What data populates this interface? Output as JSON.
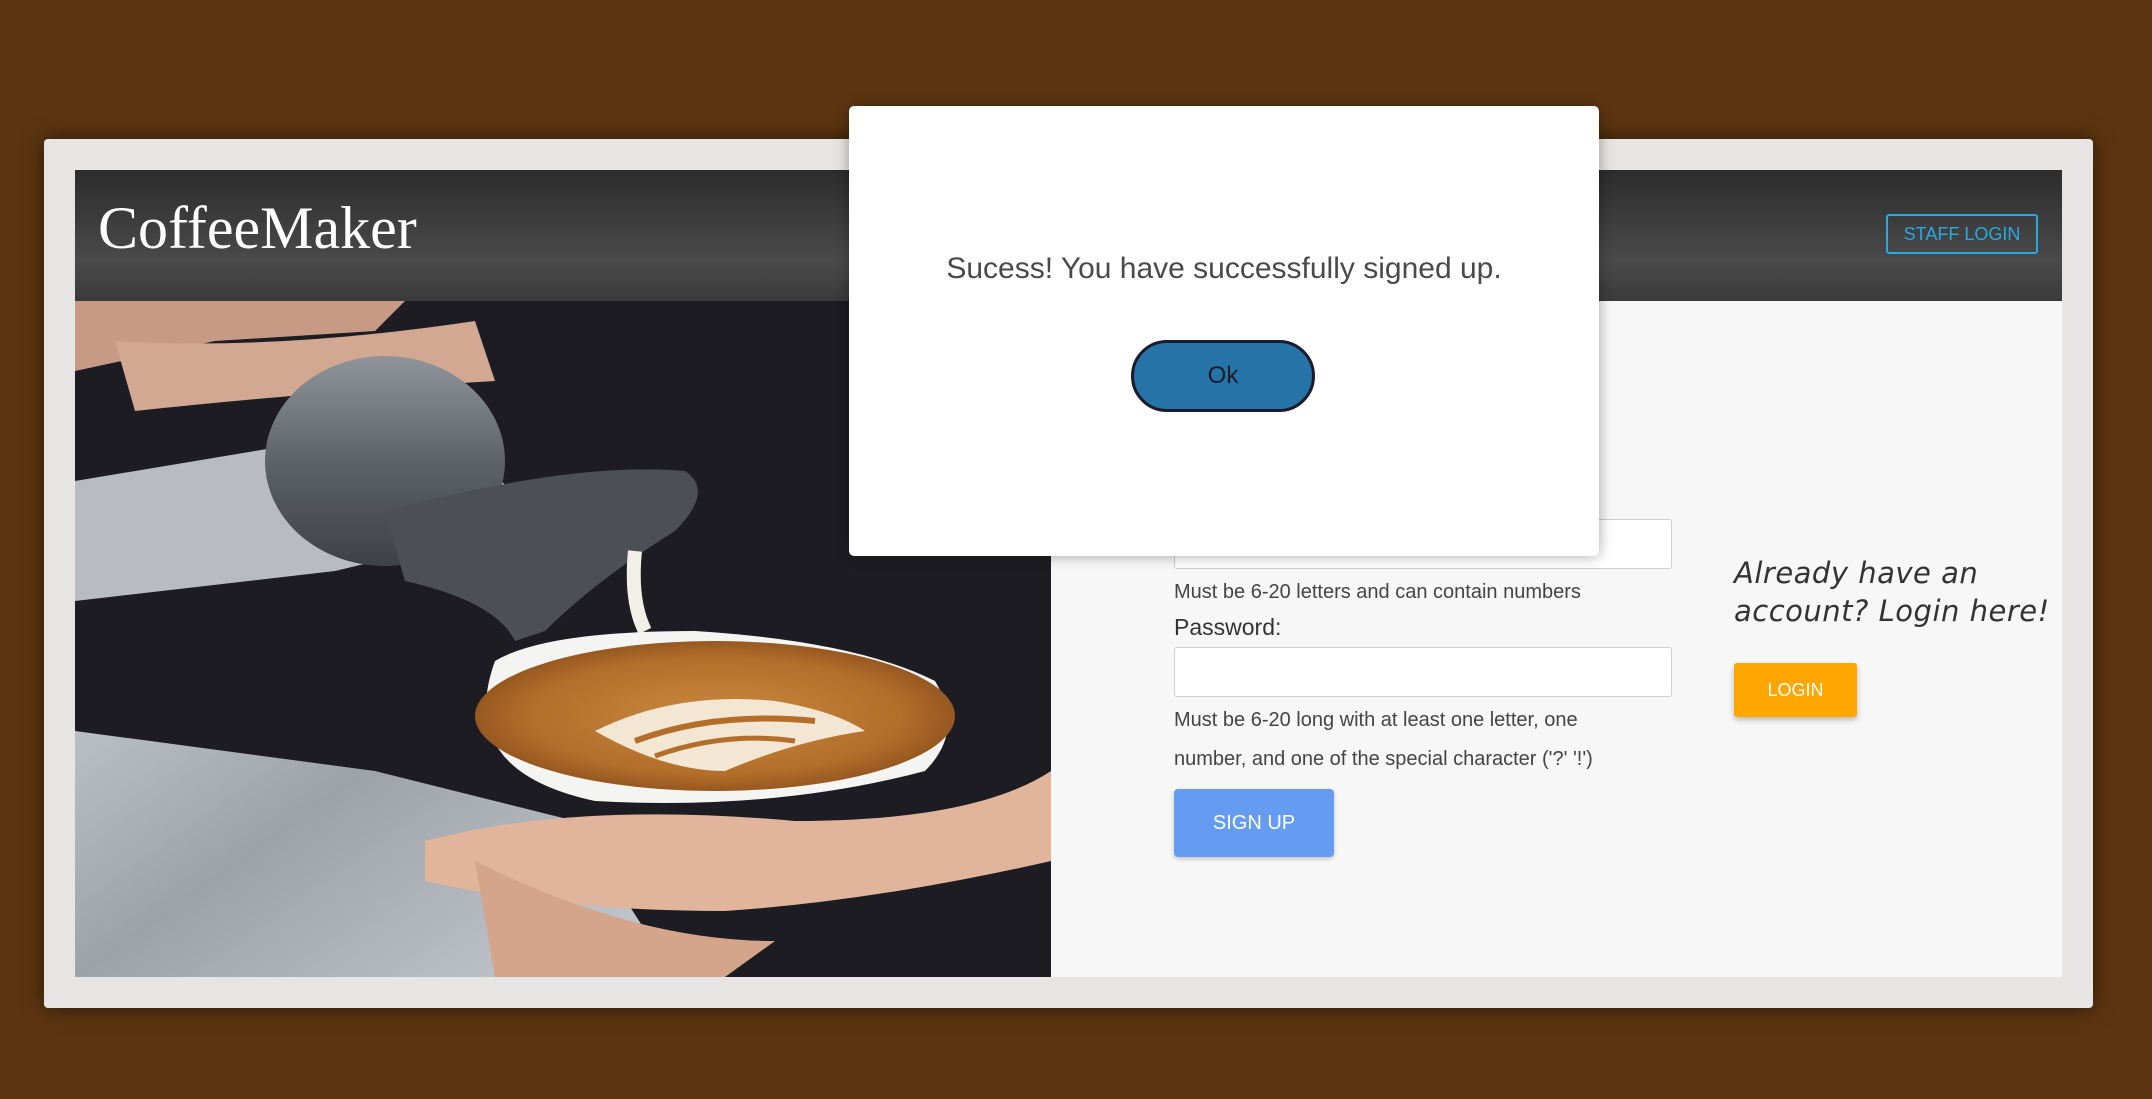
{
  "header": {
    "brand": "CoffeeMaker",
    "staff_login_label": "STAFF LOGIN"
  },
  "signup_form": {
    "username_value": "",
    "username_help": "Must be 6-20 letters and can contain numbers",
    "password_label": "Password:",
    "password_value": "",
    "password_help": "Must be 6-20 long with at least one letter, one number, and one of the special character ('?' '!')",
    "signup_label": "SIGN UP"
  },
  "login_prompt": {
    "text": "Already have an account? Login here!",
    "login_label": "LOGIN"
  },
  "modal": {
    "message": "Sucess! You have successfully signed up.",
    "ok_label": "Ok"
  },
  "colors": {
    "page_background": "#5c3510",
    "staff_login_accent": "#29a9e0",
    "signup_button": "#659cf2",
    "login_button": "#ffa600",
    "ok_button": "#2673a8"
  },
  "icons": {
    "hero_image": "latte-art-pour-photo"
  }
}
